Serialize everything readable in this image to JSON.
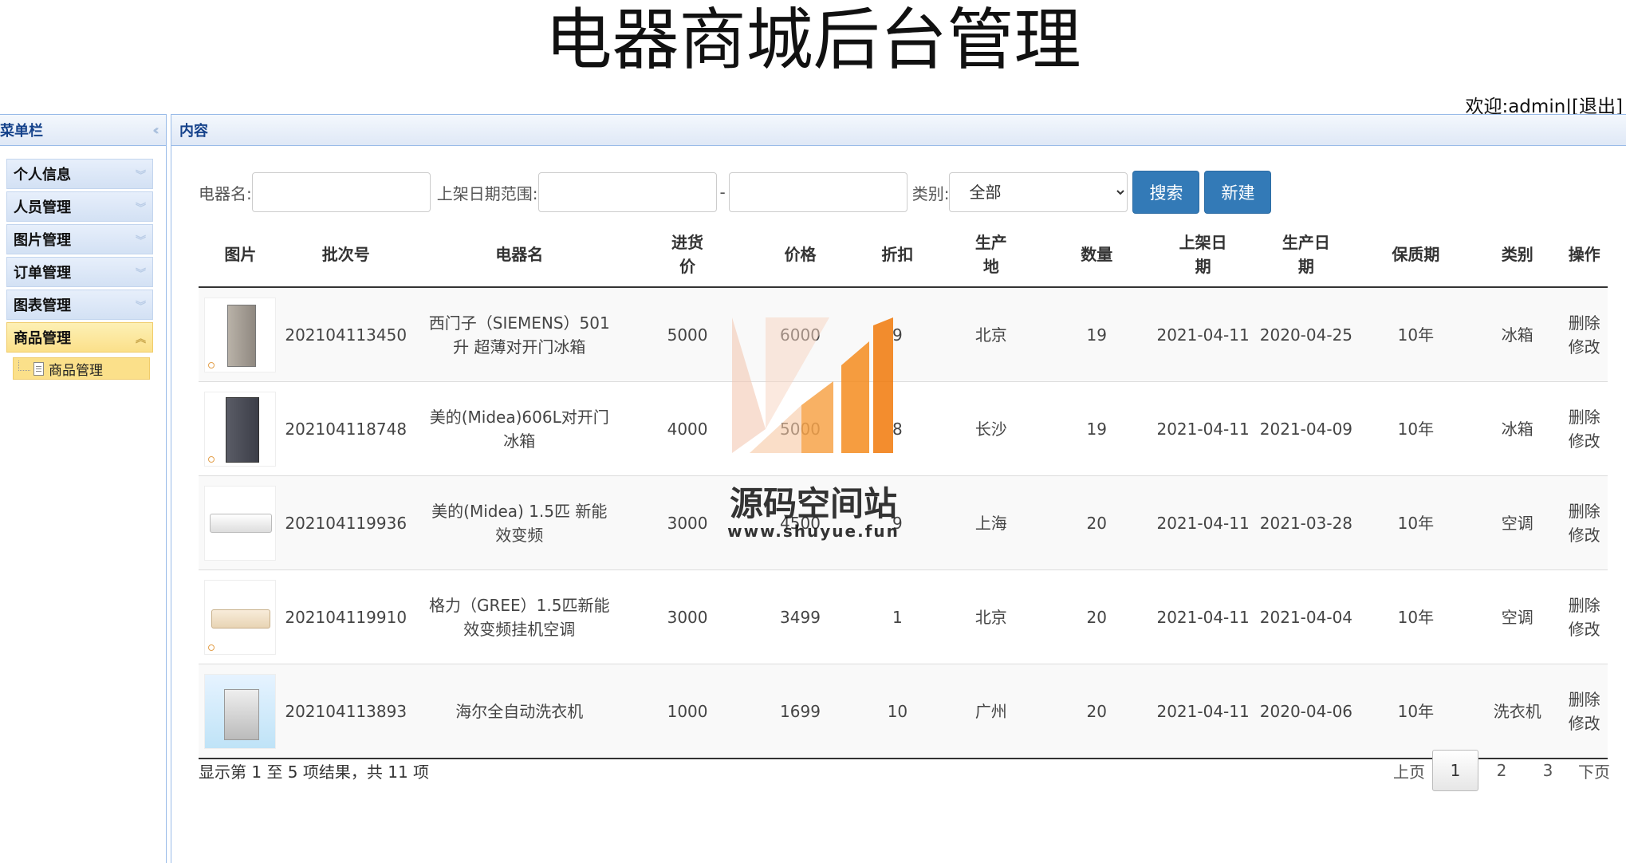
{
  "header": {
    "title": "电器商城后台管理",
    "welcome_prefix": "欢迎:admin|",
    "logout": "[退出]"
  },
  "sidebar": {
    "title": "菜单栏",
    "items": [
      {
        "label": "个人信息"
      },
      {
        "label": "人员管理"
      },
      {
        "label": "图片管理"
      },
      {
        "label": "订单管理"
      },
      {
        "label": "图表管理"
      },
      {
        "label": "商品管理"
      }
    ],
    "sub_item": "商品管理"
  },
  "content": {
    "title": "内容",
    "search": {
      "name_label": "电器名:",
      "date_label": "上架日期范围:",
      "date_sep": "-",
      "category_label": "类别:",
      "category_value": "全部",
      "search_btn": "搜索",
      "new_btn": "新建"
    },
    "columns": [
      "图片",
      "批次号",
      "电器名",
      "进货价",
      "价格",
      "折扣",
      "生产地",
      "数量",
      "上架日期",
      "生产日期",
      "保质期",
      "类别",
      "操作"
    ],
    "rows": [
      {
        "batch": "202104113450",
        "name": "西门子（SIEMENS）501升 超薄对开门冰箱",
        "cost": "5000",
        "price": "6000",
        "discount": "9",
        "origin": "北京",
        "qty": "19",
        "shelf": "2021-04-11",
        "produced": "2020-04-25",
        "warranty": "10年",
        "category": "冰箱",
        "del": "删除",
        "edit": "修改"
      },
      {
        "batch": "202104118748",
        "name": "美的(Midea)606L对开门冰箱",
        "cost": "4000",
        "price": "5000",
        "discount": "8",
        "origin": "长沙",
        "qty": "19",
        "shelf": "2021-04-11",
        "produced": "2021-04-09",
        "warranty": "10年",
        "category": "冰箱",
        "del": "删除",
        "edit": "修改"
      },
      {
        "batch": "202104119936",
        "name": "美的(Midea) 1.5匹 新能效变频",
        "cost": "3000",
        "price": "4500",
        "discount": "9",
        "origin": "上海",
        "qty": "20",
        "shelf": "2021-04-11",
        "produced": "2021-03-28",
        "warranty": "10年",
        "category": "空调",
        "del": "删除",
        "edit": "修改"
      },
      {
        "batch": "202104119910",
        "name": "格力（GREE）1.5匹新能效变频挂机空调",
        "cost": "3000",
        "price": "3499",
        "discount": "1",
        "origin": "北京",
        "qty": "20",
        "shelf": "2021-04-11",
        "produced": "2021-04-04",
        "warranty": "10年",
        "category": "空调",
        "del": "删除",
        "edit": "修改"
      },
      {
        "batch": "202104113893",
        "name": "海尔全自动洗衣机",
        "cost": "1000",
        "price": "1699",
        "discount": "10",
        "origin": "广州",
        "qty": "20",
        "shelf": "2021-04-11",
        "produced": "2020-04-06",
        "warranty": "10年",
        "category": "洗衣机",
        "del": "删除",
        "edit": "修改"
      }
    ],
    "info": "显示第 1 至 5 项结果，共 11 项",
    "pager": {
      "prev": "上页",
      "pages": [
        "1",
        "2",
        "3"
      ],
      "next": "下页",
      "current": "1"
    }
  },
  "watermark": {
    "text": "源码空间站",
    "url": "www.shuyue.fun"
  },
  "colors": {
    "primary_btn": "#337ab7",
    "active_menu": "#fbe08a",
    "panel_header": "#dfe8f6"
  }
}
